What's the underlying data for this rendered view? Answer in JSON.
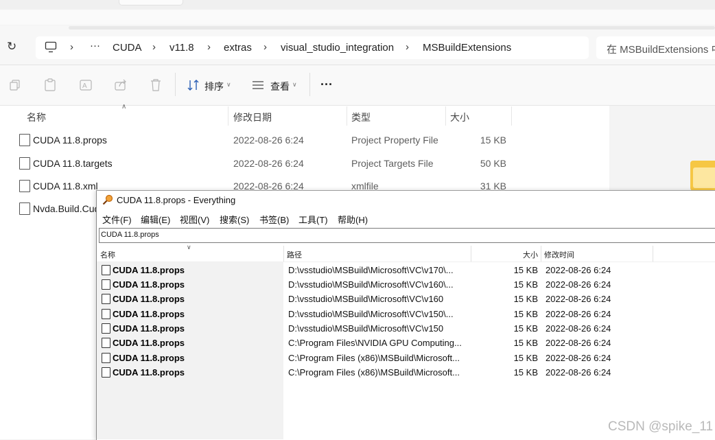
{
  "breadcrumb": {
    "overflow": "···",
    "items": [
      "CUDA",
      "v11.8",
      "extras",
      "visual_studio_integration",
      "MSBuildExtensions"
    ]
  },
  "search": {
    "placeholder": "在 MSBuildExtensions 中"
  },
  "toolbar": {
    "sort_label": "排序",
    "view_label": "查看",
    "more_label": "···"
  },
  "explorer": {
    "columns": [
      "名称",
      "修改日期",
      "类型",
      "大小"
    ],
    "files": [
      {
        "name": "CUDA 11.8.props",
        "date": "2022-08-26 6:24",
        "type": "Project Property File",
        "size": "15 KB"
      },
      {
        "name": "CUDA 11.8.targets",
        "date": "2022-08-26 6:24",
        "type": "Project Targets File",
        "size": "50 KB"
      },
      {
        "name": "CUDA 11.8.xml",
        "date": "2022-08-26 6:24",
        "type": "xmlfile",
        "size": "31 KB"
      },
      {
        "name": "Nvda.Build.Cud",
        "date": "",
        "type": "",
        "size": ""
      }
    ]
  },
  "everything": {
    "title": "CUDA 11.8.props - Everything",
    "menu": [
      "文件(F)",
      "编辑(E)",
      "视图(V)",
      "搜索(S)",
      "书签(B)",
      "工具(T)",
      "帮助(H)"
    ],
    "query": "CUDA 11.8.props",
    "columns": {
      "name": "名称",
      "path": "路径",
      "size": "大小",
      "modified": "修改时间"
    },
    "results": [
      {
        "name": "CUDA 11.8.props",
        "path": "D:\\vsstudio\\MSBuild\\Microsoft\\VC\\v170\\...",
        "size": "15 KB",
        "modified": "2022-08-26 6:24"
      },
      {
        "name": "CUDA 11.8.props",
        "path": "D:\\vsstudio\\MSBuild\\Microsoft\\VC\\v160\\...",
        "size": "15 KB",
        "modified": "2022-08-26 6:24"
      },
      {
        "name": "CUDA 11.8.props",
        "path": "D:\\vsstudio\\MSBuild\\Microsoft\\VC\\v160",
        "size": "15 KB",
        "modified": "2022-08-26 6:24"
      },
      {
        "name": "CUDA 11.8.props",
        "path": "D:\\vsstudio\\MSBuild\\Microsoft\\VC\\v150\\...",
        "size": "15 KB",
        "modified": "2022-08-26 6:24"
      },
      {
        "name": "CUDA 11.8.props",
        "path": "D:\\vsstudio\\MSBuild\\Microsoft\\VC\\v150",
        "size": "15 KB",
        "modified": "2022-08-26 6:24"
      },
      {
        "name": "CUDA 11.8.props",
        "path": "C:\\Program Files\\NVIDIA GPU Computing...",
        "size": "15 KB",
        "modified": "2022-08-26 6:24"
      },
      {
        "name": "CUDA 11.8.props",
        "path": "C:\\Program Files (x86)\\MSBuild\\Microsoft...",
        "size": "15 KB",
        "modified": "2022-08-26 6:24"
      },
      {
        "name": "CUDA 11.8.props",
        "path": "C:\\Program Files (x86)\\MSBuild\\Microsoft...",
        "size": "15 KB",
        "modified": "2022-08-26 6:24"
      }
    ]
  },
  "watermark": "CSDN @spike_11",
  "icons": {
    "refresh": "refresh-icon",
    "computer": "computer-icon",
    "copy": "copy-icon",
    "paste": "paste-icon",
    "rename": "rename-icon",
    "share": "share-icon",
    "delete": "delete-icon",
    "sort": "sort-icon",
    "view": "view-icon"
  }
}
